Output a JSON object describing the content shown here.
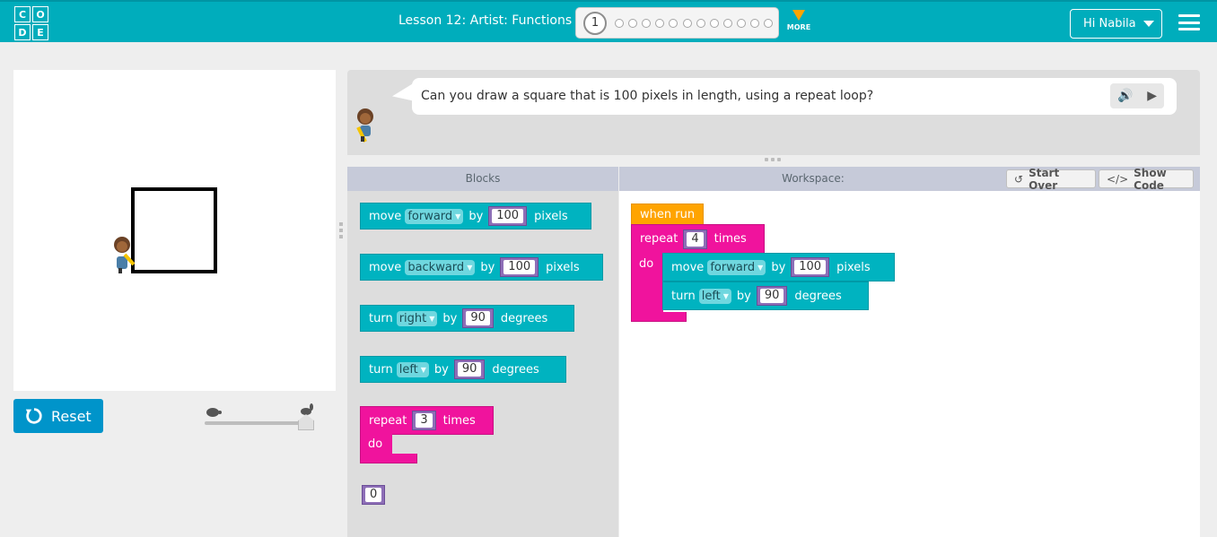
{
  "header": {
    "logo_letters": [
      "C",
      "O",
      "D",
      "E"
    ],
    "lesson_title": "Lesson 12: Artist: Functions",
    "current_level": "1",
    "more_label": "MORE",
    "user_label": "Hi Nabila"
  },
  "instructions": {
    "text": "Can you draw a square that is 100 pixels in length, using a repeat loop?"
  },
  "controls": {
    "reset_label": "Reset"
  },
  "panels": {
    "blocks_title": "Blocks",
    "workspace_title": "Workspace:",
    "start_over_label": "Start Over",
    "show_code_label": "Show Code"
  },
  "toolbox": {
    "move_forward": {
      "word": "move",
      "dir": "forward",
      "by": "by",
      "value": "100",
      "unit": "pixels"
    },
    "move_backward": {
      "word": "move",
      "dir": "backward",
      "by": "by",
      "value": "100",
      "unit": "pixels"
    },
    "turn_right": {
      "word": "turn",
      "dir": "right",
      "by": "by",
      "value": "90",
      "unit": "degrees"
    },
    "turn_left": {
      "word": "turn",
      "dir": "left",
      "by": "by",
      "value": "90",
      "unit": "degrees"
    },
    "repeat": {
      "word": "repeat",
      "value": "3",
      "unit": "times",
      "do": "do"
    },
    "number": {
      "value": "0"
    }
  },
  "workspace": {
    "when_run": "when run",
    "repeat": {
      "word": "repeat",
      "value": "4",
      "unit": "times",
      "do": "do"
    },
    "move": {
      "word": "move",
      "dir": "forward",
      "by": "by",
      "value": "100",
      "unit": "pixels"
    },
    "turn": {
      "word": "turn",
      "dir": "left",
      "by": "by",
      "value": "90",
      "unit": "degrees"
    }
  },
  "colors": {
    "header": "#00adbc",
    "teal_block": "#00b3c0",
    "pink_block": "#f0139d",
    "orange_block": "#ffa400",
    "reset_button": "#0094ca"
  }
}
